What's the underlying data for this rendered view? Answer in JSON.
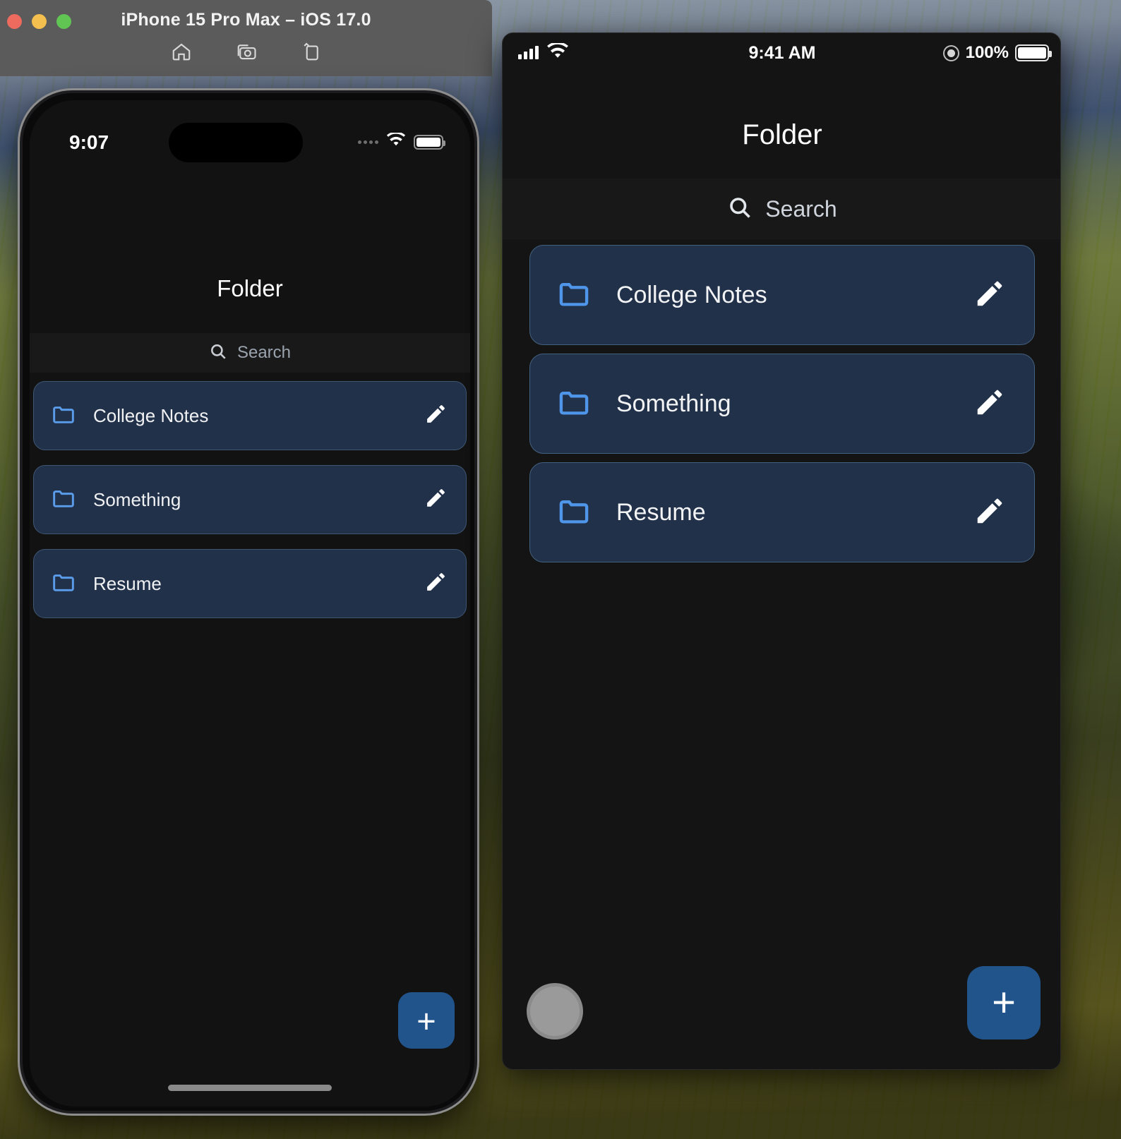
{
  "simulator_window": {
    "title": "iPhone 15 Pro Max – iOS 17.0",
    "traffic_lights": [
      {
        "name": "close",
        "color": "#ed6a5f"
      },
      {
        "name": "minimize",
        "color": "#f5bf4f"
      },
      {
        "name": "zoom",
        "color": "#61c554"
      }
    ],
    "toolbar": [
      {
        "icon": "home-icon",
        "label": "Home"
      },
      {
        "icon": "screenshot-camera-icon",
        "label": "Screenshot"
      },
      {
        "icon": "rotate-device-icon",
        "label": "Rotate"
      }
    ]
  },
  "left_phone": {
    "status_bar": {
      "time": "9:07",
      "signal_icon": "signal-dots-icon",
      "wifi_icon": "wifi-icon",
      "battery_icon": "battery-full-icon"
    },
    "nav_title": "Folder",
    "search": {
      "icon": "search-icon",
      "placeholder": "Search",
      "value": ""
    },
    "folders": [
      {
        "icon": "folder-icon",
        "name": "College Notes",
        "action_icon": "pencil-edit-icon"
      },
      {
        "icon": "folder-icon",
        "name": "Something",
        "action_icon": "pencil-edit-icon"
      },
      {
        "icon": "folder-icon",
        "name": "Resume",
        "action_icon": "pencil-edit-icon"
      }
    ],
    "fab": {
      "icon": "plus-icon",
      "label": "+"
    },
    "home_indicator": true
  },
  "right_phone": {
    "status_bar": {
      "signal_icon": "signal-bars-icon",
      "wifi_icon": "wifi-icon",
      "time": "9:41 AM",
      "location_icon": "location-indicator-icon",
      "battery_percent": "100%",
      "battery_icon": "battery-full-icon"
    },
    "nav_title": "Folder",
    "search": {
      "icon": "search-icon",
      "placeholder": "Search",
      "value": ""
    },
    "folders": [
      {
        "icon": "folder-icon",
        "name": "College Notes",
        "action_icon": "pencil-edit-icon"
      },
      {
        "icon": "folder-icon",
        "name": "Something",
        "action_icon": "pencil-edit-icon"
      },
      {
        "icon": "folder-icon",
        "name": "Resume",
        "action_icon": "pencil-edit-icon"
      }
    ],
    "fab": {
      "icon": "plus-icon",
      "label": "+"
    },
    "assistive_touch": {
      "icon": "assistive-touch-icon"
    }
  },
  "colors": {
    "card_fill": "#22314a",
    "card_border": "#42607f",
    "folder_icon": "#4f96ea",
    "fab_blue": "#22548c",
    "screen_bg": "#141414",
    "titlebar": "#5b5b5b"
  }
}
